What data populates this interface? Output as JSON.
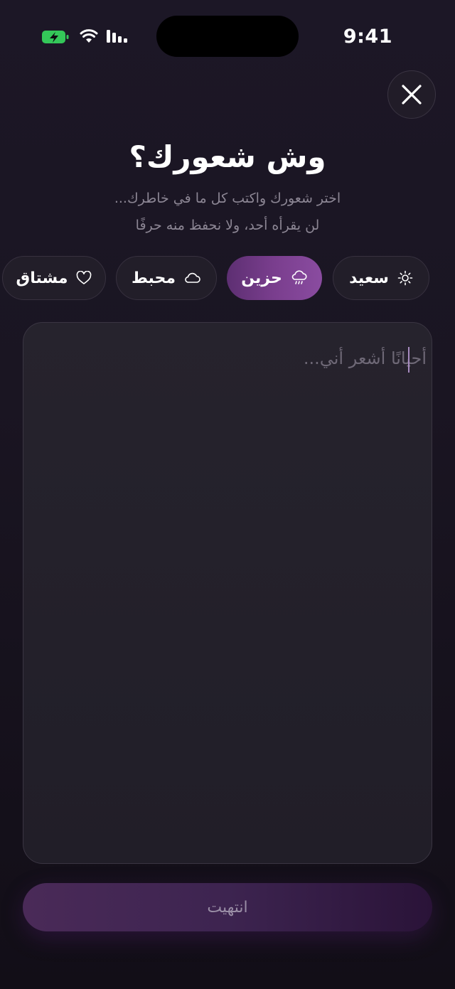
{
  "status_bar": {
    "time": "9:41"
  },
  "header": {
    "title": "وش شعورك؟",
    "subtitle_line1": "اختر شعورك واكتب كل ما في خاطرك...",
    "subtitle_line2": "لن يقرأه أحد، ولا نحفظ منه حرفًا"
  },
  "moods": [
    {
      "label": "سعيد",
      "icon": "sun-icon",
      "selected": false
    },
    {
      "label": "حزين",
      "icon": "rain-cloud-icon",
      "selected": true
    },
    {
      "label": "محبط",
      "icon": "cloud-icon",
      "selected": false
    },
    {
      "label": "مشتاق",
      "icon": "heart-icon",
      "selected": false
    }
  ],
  "entry": {
    "placeholder": "أحيانًا أشعر أني..."
  },
  "actions": {
    "done_label": "انتهيت"
  },
  "colors": {
    "accent": "#7a3e8e",
    "background": "#1a1522",
    "battery_green": "#34c759"
  }
}
